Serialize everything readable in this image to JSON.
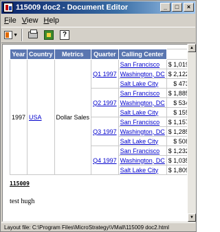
{
  "window": {
    "title": "115009 doc2 - Document Editor"
  },
  "window_buttons": {
    "minimize": "_",
    "maximize": "□",
    "close": "×"
  },
  "menu": [
    {
      "accel": "F",
      "rest": "ile"
    },
    {
      "accel": "V",
      "rest": "iew"
    },
    {
      "accel": "H",
      "rest": "elp"
    }
  ],
  "toolbar": {
    "icons": [
      "view-icon",
      "print-icon",
      "export-icon",
      "help-icon"
    ],
    "help_glyph": "?"
  },
  "report": {
    "headers": [
      "Year",
      "Country",
      "Metrics",
      "Quarter",
      "Calling Center"
    ],
    "year": "1997",
    "country": "USA",
    "metric": "Dollar Sales",
    "quarters": [
      {
        "label": "Q1 1997",
        "rows": [
          {
            "center": "San Francisco",
            "value": "$ 1,019"
          },
          {
            "center": "Washington, DC",
            "value": "$ 2,122"
          },
          {
            "center": "Salt Lake City",
            "value": "$ 473"
          }
        ]
      },
      {
        "label": "Q2 1997",
        "rows": [
          {
            "center": "San Francisco",
            "value": "$ 1,885"
          },
          {
            "center": "Washington, DC",
            "value": "$ 534"
          },
          {
            "center": "Salt Lake City",
            "value": "$ 155"
          }
        ]
      },
      {
        "label": "Q3 1997",
        "rows": [
          {
            "center": "San Francisco",
            "value": "$ 1,157"
          },
          {
            "center": "Washington, DC",
            "value": "$ 1,285"
          },
          {
            "center": "Salt Lake City",
            "value": "$ 508"
          }
        ]
      },
      {
        "label": "Q4 1997",
        "rows": [
          {
            "center": "San Francisco",
            "value": "$ 1,232"
          },
          {
            "center": "Washington, DC",
            "value": "$ 1,035"
          },
          {
            "center": "Salt Lake City",
            "value": "$ 1,809"
          }
        ]
      }
    ]
  },
  "document": {
    "title": "115009",
    "body": "test hugh"
  },
  "statusbar": {
    "text": "Layout file: C:\\Program Files\\MicroStrategy\\VMall\\115009 doc2.html"
  },
  "colors": {
    "titlebar": "#0a246a",
    "header": "#5a76b0",
    "link": "#0000cc"
  }
}
